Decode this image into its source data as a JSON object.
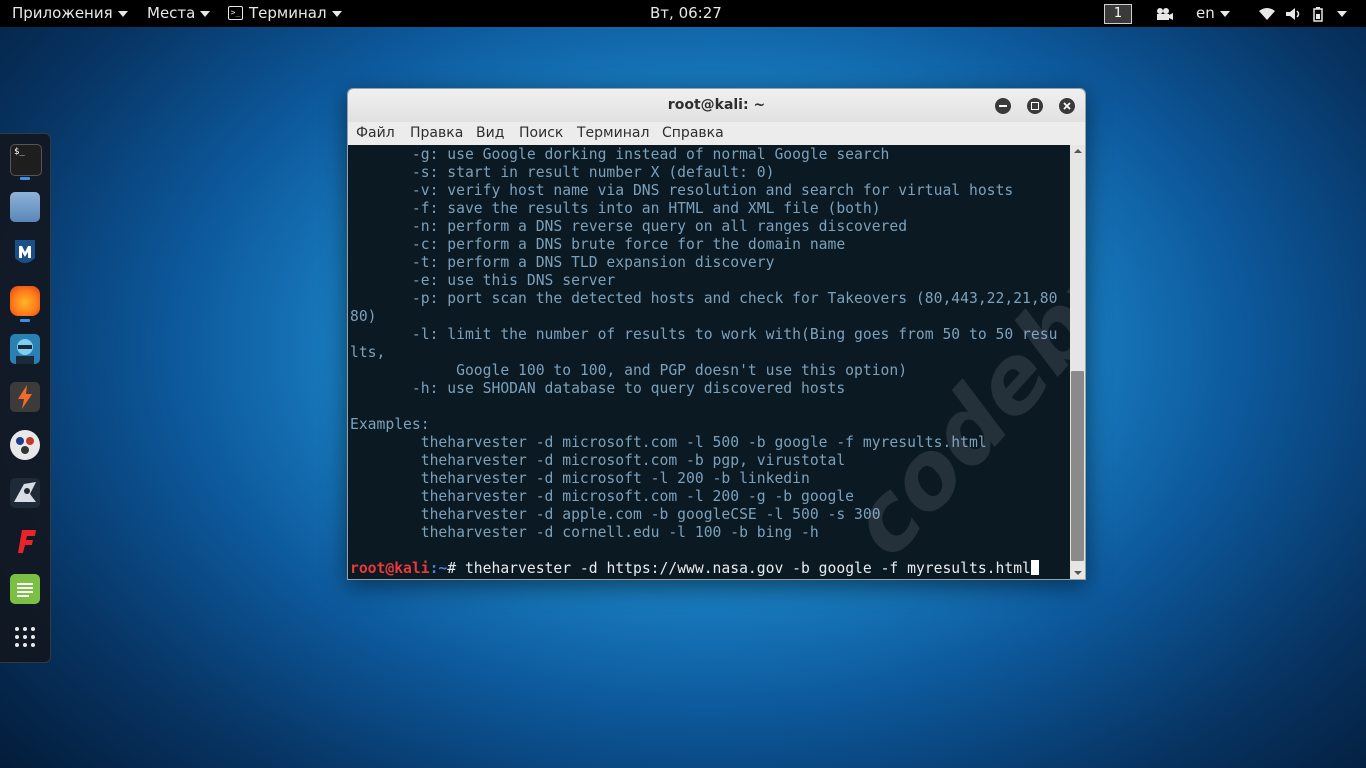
{
  "top_panel": {
    "applications": "Приложения",
    "places": "Места",
    "terminal": "Терминал",
    "clock": "Вт, 06:27",
    "workspace": "1",
    "keyboard_layout": "en"
  },
  "dock": {
    "items": [
      {
        "name": "terminal",
        "icon": "terminal-icon"
      },
      {
        "name": "files",
        "icon": "folder-icon"
      },
      {
        "name": "metasploit",
        "icon": "metasploit-icon"
      },
      {
        "name": "firefox",
        "icon": "firefox-icon"
      },
      {
        "name": "armitage",
        "icon": "armitage-icon"
      },
      {
        "name": "burpsuite",
        "icon": "burpsuite-icon"
      },
      {
        "name": "maltego",
        "icon": "maltego-icon"
      },
      {
        "name": "beef",
        "icon": "beef-icon"
      },
      {
        "name": "faraday",
        "icon": "faraday-icon"
      },
      {
        "name": "leafpad",
        "icon": "text-editor-icon"
      },
      {
        "name": "show-applications",
        "icon": "app-grid-icon"
      }
    ]
  },
  "window": {
    "title": "root@kali: ~",
    "menu": [
      "Файл",
      "Правка",
      "Вид",
      "Поиск",
      "Терминал",
      "Справка"
    ]
  },
  "terminal": {
    "lines": [
      "       -g: use Google dorking instead of normal Google search",
      "       -s: start in result number X (default: 0)",
      "       -v: verify host name via DNS resolution and search for virtual hosts",
      "       -f: save the results into an HTML and XML file (both)",
      "       -n: perform a DNS reverse query on all ranges discovered",
      "       -c: perform a DNS brute force for the domain name",
      "       -t: perform a DNS TLD expansion discovery",
      "       -e: use this DNS server",
      "       -p: port scan the detected hosts and check for Takeovers (80,443,22,21,80",
      "80)",
      "       -l: limit the number of results to work with(Bing goes from 50 to 50 resu",
      "lts,",
      "            Google 100 to 100, and PGP doesn't use this option)",
      "       -h: use SHODAN database to query discovered hosts",
      "",
      "Examples:",
      "        theharvester -d microsoft.com -l 500 -b google -f myresults.html",
      "        theharvester -d microsoft.com -b pgp, virustotal",
      "        theharvester -d microsoft -l 200 -b linkedin",
      "        theharvester -d microsoft.com -l 200 -g -b google",
      "        theharvester -d apple.com -b googleCSE -l 500 -s 300",
      "        theharvester -d cornell.edu -l 100 -b bing -h",
      ""
    ],
    "prompt_user": "root@kali",
    "prompt_path": ":~",
    "prompt_symbol": "#",
    "command": " theharvester -d https://www.nasa.gov -b google -f myresults.html"
  },
  "watermark": "codeby.net"
}
